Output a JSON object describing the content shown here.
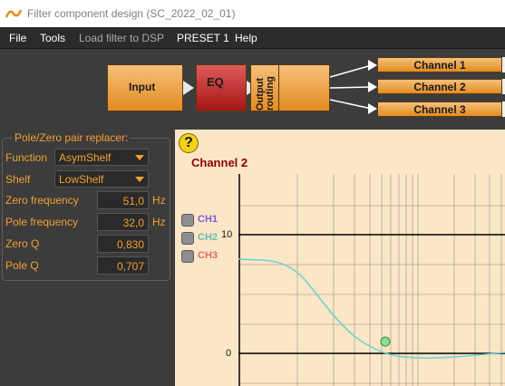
{
  "window": {
    "title": "Filter component design (SC_2022_02_01)"
  },
  "menu": {
    "file": "File",
    "tools": "Tools",
    "load": "Load filter to DSP",
    "preset": "PRESET 1",
    "help": "Help"
  },
  "flow": {
    "input": "Input",
    "eq": "EQ",
    "routing": "Output routing",
    "channels": [
      "Channel 1",
      "Channel 2",
      "Channel 3"
    ]
  },
  "panel": {
    "title": "Pole/Zero pair replacer:",
    "function_label": "Function",
    "function_value": "AsymShelf",
    "shelf_label": "Shelf",
    "shelf_value": "LowShelf",
    "zero_freq_label": "Zero frequency",
    "zero_freq_value": "51,0",
    "zero_freq_unit": "Hz",
    "pole_freq_label": "Pole frequency",
    "pole_freq_value": "32,0",
    "pole_freq_unit": "Hz",
    "zero_q_label": "Zero Q",
    "zero_q_value": "0,830",
    "pole_q_label": "Pole Q",
    "pole_q_value": "0,707"
  },
  "graph": {
    "help": "?",
    "title": "Channel 2",
    "legend": [
      {
        "label": "CH1",
        "color": "#7a5ae0"
      },
      {
        "label": "CH2",
        "color": "#5fbfb0"
      },
      {
        "label": "CH3",
        "color": "#e06a6a"
      }
    ],
    "y_ticks": [
      "10",
      "0"
    ],
    "curve_color": "#6ecfd0",
    "marker_color": "#8ee08e"
  },
  "colors": {
    "accent_orange": "#f0a030",
    "block_orange": "#e38b22",
    "eq_red": "#a51515",
    "graph_bg": "#fbe6c6"
  }
}
